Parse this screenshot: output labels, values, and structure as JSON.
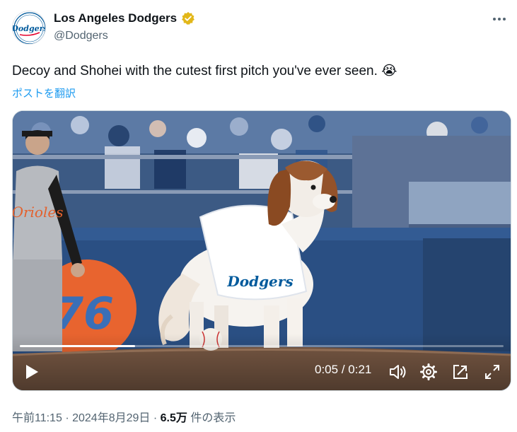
{
  "account": {
    "display_name": "Los Angeles Dodgers",
    "handle": "@Dodgers",
    "avatar_text": "Dodgers",
    "verified_badge": "gold-verified-badge-icon",
    "more_icon": "more-horizontal-icon"
  },
  "tweet": {
    "text": "Decoy and Shohei with the cutest first pitch you've ever seen.",
    "emoji": "😭",
    "translate_link": "ポストを翻訳"
  },
  "media": {
    "type": "video",
    "current_time": "0:05",
    "separator": "/",
    "duration": "0:21",
    "progress_fraction": 0.238,
    "jersey_text": "Dodgers",
    "controls": [
      "play-icon",
      "volume-icon",
      "settings-gear-icon",
      "popout-icon",
      "fullscreen-icon"
    ]
  },
  "meta": {
    "time": "午前11:15",
    "date": "2024年8月29日",
    "dot": "·",
    "views_count": "6.5万",
    "views_label": "件の表示"
  },
  "colors": {
    "verified_gold": "#e2b719",
    "link_blue": "#1d9bf0",
    "dodger_blue": "#005a9c",
    "secondary_text": "#536471"
  }
}
